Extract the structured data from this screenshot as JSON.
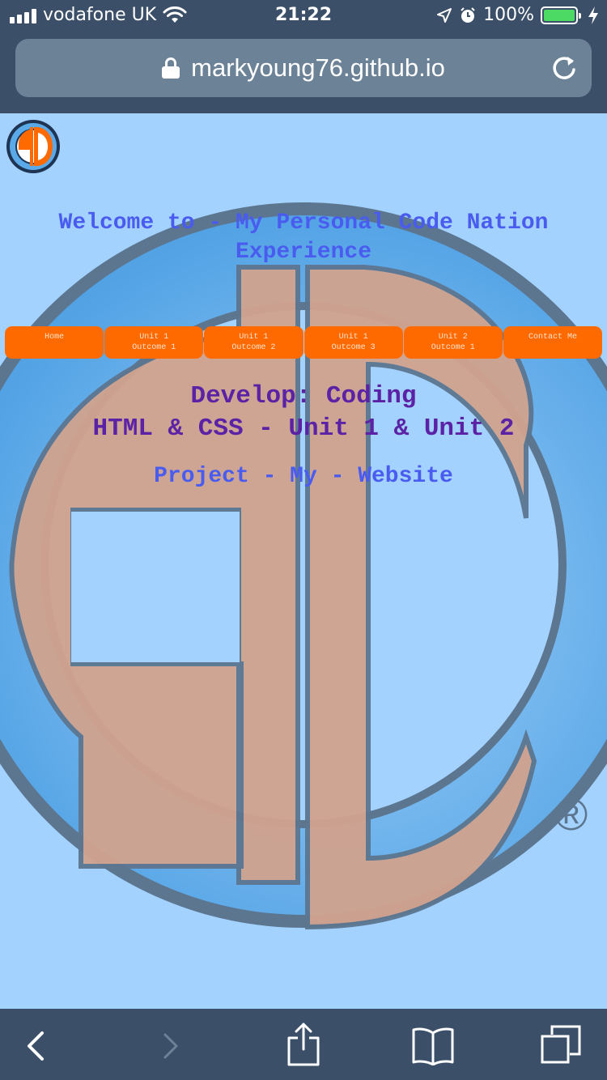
{
  "status_bar": {
    "carrier": "vodafone UK",
    "time": "21:22",
    "battery_percent": "100%",
    "signal-icon": "signal-bars-icon",
    "wifi-icon": "wifi-icon",
    "location-icon": "location-arrow-icon",
    "alarm-icon": "alarm-clock-icon",
    "charging-icon": "bolt-icon"
  },
  "browser": {
    "url": "markyoung76.github.io",
    "lock_icon": "lock-icon",
    "reload_icon": "reload-icon"
  },
  "page": {
    "welcome": "Welcome to - My Personal Code Nation Experience",
    "nav": [
      {
        "line1": "Home",
        "line2": ""
      },
      {
        "line1": "Unit 1",
        "line2": "Outcome 1"
      },
      {
        "line1": "Unit 1",
        "line2": "Outcome 2"
      },
      {
        "line1": "Unit 1",
        "line2": "Outcome 3"
      },
      {
        "line1": "Unit 2",
        "line2": "Outcome 1"
      },
      {
        "line1": "Contact Me",
        "line2": ""
      }
    ],
    "heading_line1": "Develop: Coding",
    "heading_line2": "HTML & CSS - Unit 1 & Unit 2",
    "project": "Project - My - Website",
    "registered_mark": "®"
  },
  "toolbar": {
    "back": "back-chevron-icon",
    "forward": "forward-chevron-icon",
    "share": "share-icon",
    "bookmarks": "bookmarks-icon",
    "tabs": "tabs-icon"
  },
  "colors": {
    "chrome": "#3b5068",
    "page_background": "#a3d2ff",
    "nav_orange": "#ff6a00",
    "heading_purple": "#5b22a6",
    "link_blue": "#4a5cf0"
  }
}
